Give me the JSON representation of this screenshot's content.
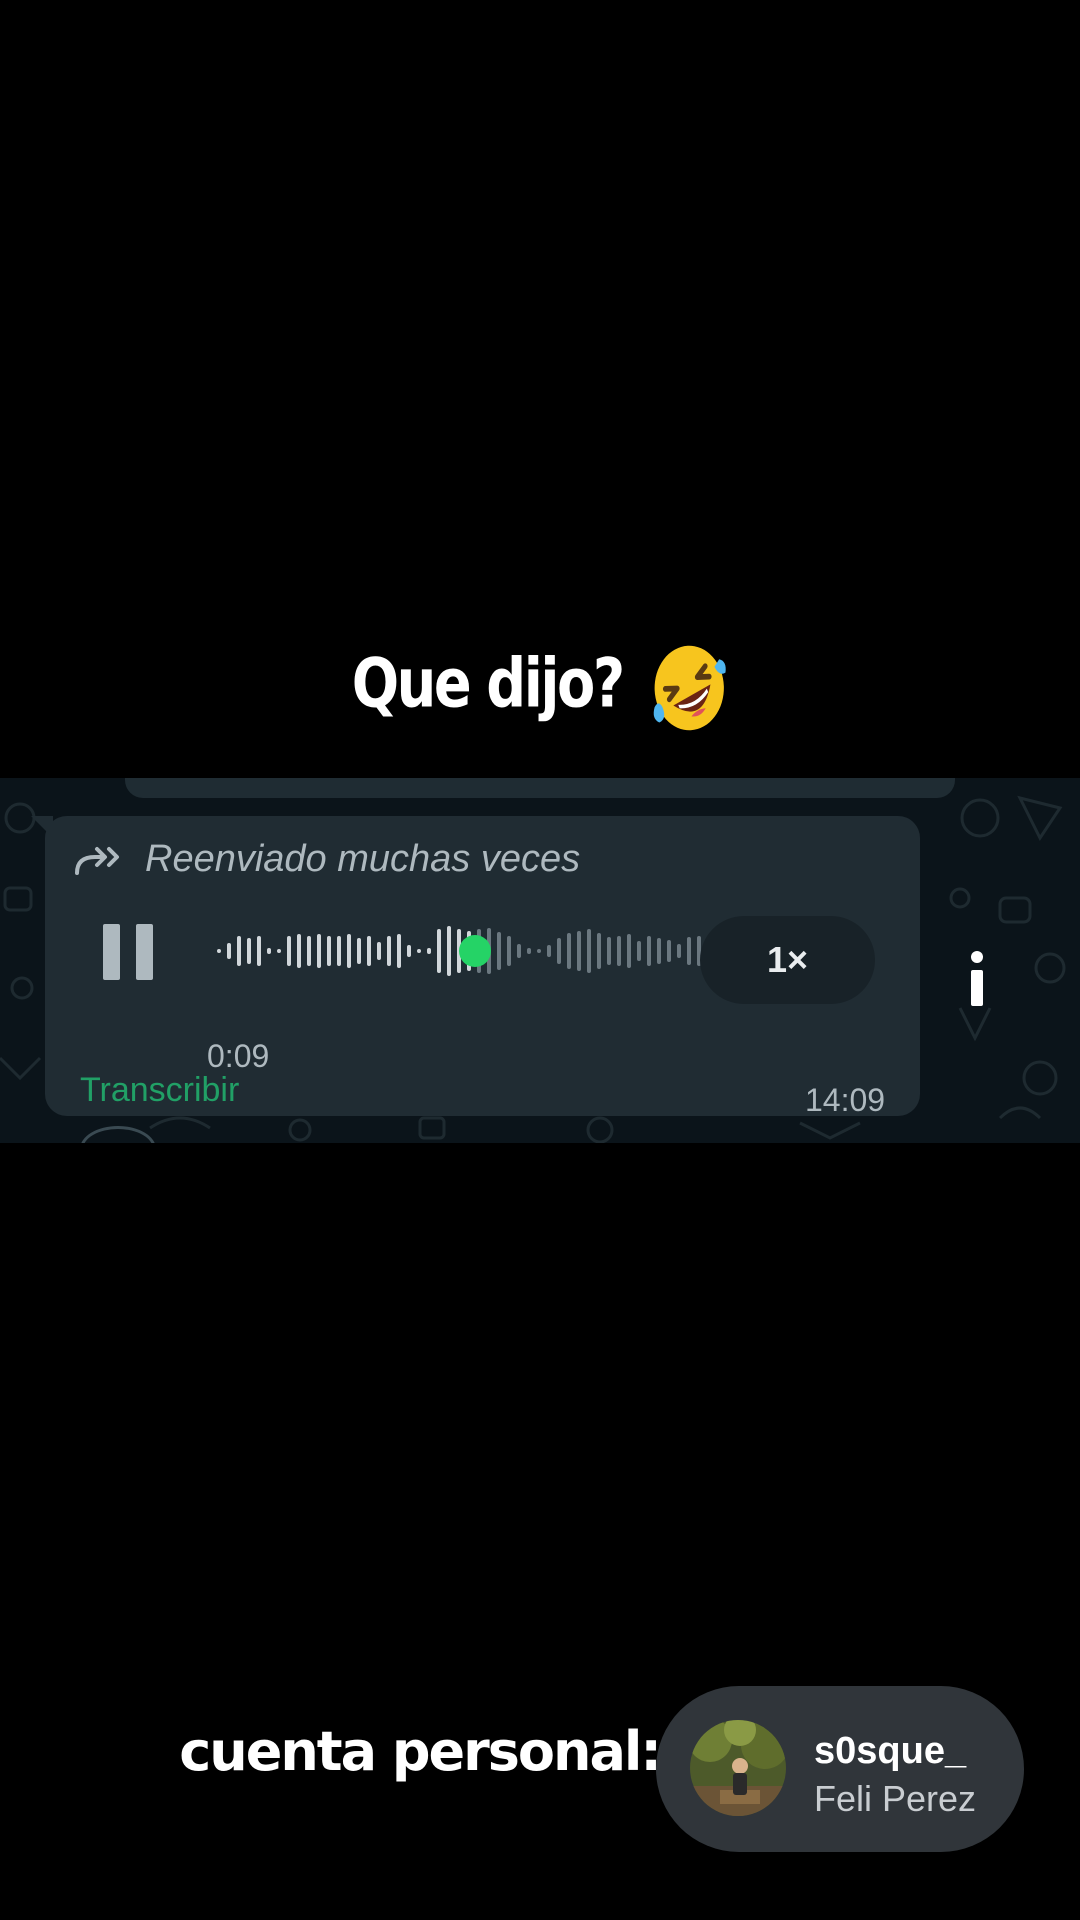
{
  "caption": {
    "text": "Que dijo?",
    "emoji_icon": "rolling-on-floor-laughing-emoji"
  },
  "message": {
    "forwarded_label": "Reenviado muchas veces",
    "playback_state": "playing",
    "elapsed": "0:09",
    "playback_progress": 0.5,
    "speed_label": "1×",
    "transcribe_label": "Transcribir",
    "time": "14:09"
  },
  "colors": {
    "chat_background": "#0b141a",
    "bubble": "#202c33",
    "progress_dot": "#25d366",
    "transcribe_link": "#21a066",
    "secondary_text": "#aeb9bf"
  },
  "footer": {
    "label": "cuenta personal:",
    "account": {
      "handle": "s0sque_",
      "name": "Feli Perez"
    }
  }
}
